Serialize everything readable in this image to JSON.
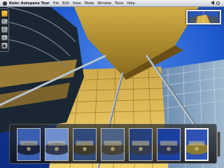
{
  "menubar": {
    "app_name": "Kolor Autopano Tour",
    "items": [
      "File",
      "Edit",
      "View",
      "Mode",
      "Window",
      "Tools",
      "Help"
    ],
    "clock_icon": "clock-icon",
    "volume_icon": "volume-icon"
  },
  "toolbar": {
    "tools": [
      {
        "icon": "hand-icon",
        "glyph": "✋",
        "active": true
      },
      {
        "icon": "pointer-icon",
        "glyph": "↖",
        "active": false
      },
      {
        "icon": "hotspot-icon",
        "glyph": "◎",
        "active": false
      },
      {
        "icon": "zoom-icon",
        "glyph": "⌕",
        "active": false
      },
      {
        "icon": "fullscreen-icon",
        "glyph": "▣",
        "active": false
      }
    ]
  },
  "navigator": {
    "icon": "panorama-preview-icon"
  },
  "filmstrip": {
    "thumbnails": [
      {
        "name": "panorama-thumbnail-1",
        "sky": "#3a5fb0",
        "ground": "#1b2440",
        "selected": false
      },
      {
        "name": "panorama-thumbnail-2",
        "sky": "#6f8fd0",
        "ground": "#30384f",
        "selected": false
      },
      {
        "name": "panorama-thumbnail-3",
        "sky": "#324a7a",
        "ground": "#3c3a2a",
        "selected": false
      },
      {
        "name": "panorama-thumbnail-4",
        "sky": "#4d6385",
        "ground": "#474237",
        "selected": false
      },
      {
        "name": "panorama-thumbnail-5",
        "sky": "#26407d",
        "ground": "#333b4c",
        "selected": false
      },
      {
        "name": "panorama-thumbnail-6",
        "sky": "#1c3fa2",
        "ground": "#28345c",
        "selected": false
      },
      {
        "name": "panorama-thumbnail-7",
        "sky": "#2f52b6",
        "ground": "#8a7a32",
        "selected": true
      }
    ]
  },
  "colors": {
    "sky": "#1f5bd1",
    "canopy": "#c9a336",
    "facade_light": "#f0d070",
    "building_dark": "#1a2733"
  }
}
